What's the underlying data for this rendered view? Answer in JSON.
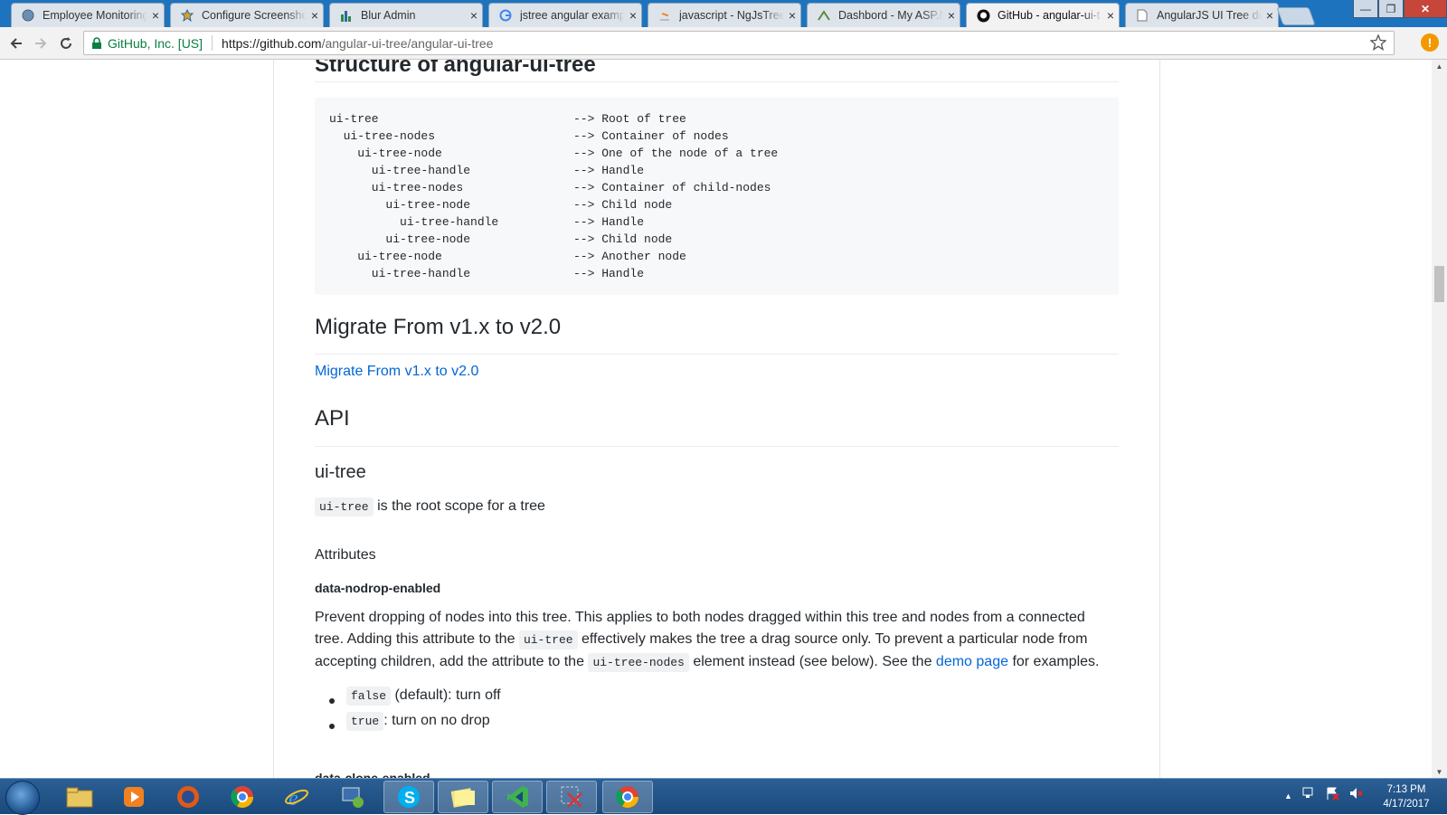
{
  "tabs": [
    {
      "title": "Employee Monitoring",
      "icon": "globe-icon"
    },
    {
      "title": "Configure Screenshot",
      "icon": "gear-star-icon"
    },
    {
      "title": "Blur Admin",
      "icon": "bar-chart-icon"
    },
    {
      "title": "jstree angular examp",
      "icon": "google-icon"
    },
    {
      "title": "javascript - NgJsTree",
      "icon": "stackoverflow-icon"
    },
    {
      "title": "Dashbord - My ASP.N",
      "icon": "aspnet-icon"
    },
    {
      "title": "GitHub - angular-ui-t",
      "icon": "github-icon"
    },
    {
      "title": "AngularJS UI Tree de",
      "icon": "document-icon"
    }
  ],
  "toolbar": {
    "security_label": "GitHub, Inc. [US]",
    "url_host": "https://github.com",
    "url_path": "/angular-ui-tree/angular-ui-tree"
  },
  "page": {
    "section_title": "Structure of angular-ui-tree",
    "code_lines": [
      {
        "code": "ui-tree",
        "comment": "--> Root of tree"
      },
      {
        "code": "  ui-tree-nodes",
        "comment": "--> Container of nodes"
      },
      {
        "code": "    ui-tree-node",
        "comment": "--> One of the node of a tree"
      },
      {
        "code": "      ui-tree-handle",
        "comment": "--> Handle"
      },
      {
        "code": "      ui-tree-nodes",
        "comment": "--> Container of child-nodes"
      },
      {
        "code": "        ui-tree-node",
        "comment": "--> Child node"
      },
      {
        "code": "          ui-tree-handle",
        "comment": "--> Handle"
      },
      {
        "code": "        ui-tree-node",
        "comment": "--> Child node"
      },
      {
        "code": "    ui-tree-node",
        "comment": "--> Another node"
      },
      {
        "code": "      ui-tree-handle",
        "comment": "--> Handle"
      }
    ],
    "migrate_heading": "Migrate From v1.x to v2.0",
    "migrate_link": "Migrate From v1.x to v2.0",
    "api_heading": "API",
    "uitree_heading": "ui-tree",
    "uitree_code": "ui-tree",
    "uitree_desc": "is the root scope for a tree",
    "attributes_heading": "Attributes",
    "attr_heading": "data-nodrop-enabled",
    "desc_part1": "Prevent dropping of nodes into this tree. This applies to both nodes dragged within this tree and nodes from a connected tree. Adding this attribute to the",
    "desc_code1": "ui-tree",
    "desc_part2": "effectively makes the tree a drag source only. To prevent a particular node from accepting children, add the attribute to the",
    "desc_code2": "ui-tree-nodes",
    "desc_part3": "element instead (see below). See the",
    "desc_link": "demo page",
    "desc_part4": "for examples.",
    "list_items": [
      {
        "code": "false",
        "text": "(default): turn off"
      },
      {
        "code": "true",
        "text": ": turn on no drop"
      }
    ],
    "next_heading": "data-clone-enabled"
  },
  "taskbar": {
    "apps": [
      "file-explorer-icon",
      "media-player-icon",
      "firefox-icon",
      "chrome-icon",
      "internet-explorer-icon",
      "network-manager-icon",
      "skype-icon",
      "sticky-notes-icon",
      "visual-studio-icon",
      "snipping-tool-icon",
      "chrome-icon"
    ],
    "time": "7:13 PM",
    "date": "4/17/2017"
  },
  "colors": {
    "link": "#0366d6",
    "taskbar": "#1a4a7c",
    "secure": "#0b8043"
  }
}
